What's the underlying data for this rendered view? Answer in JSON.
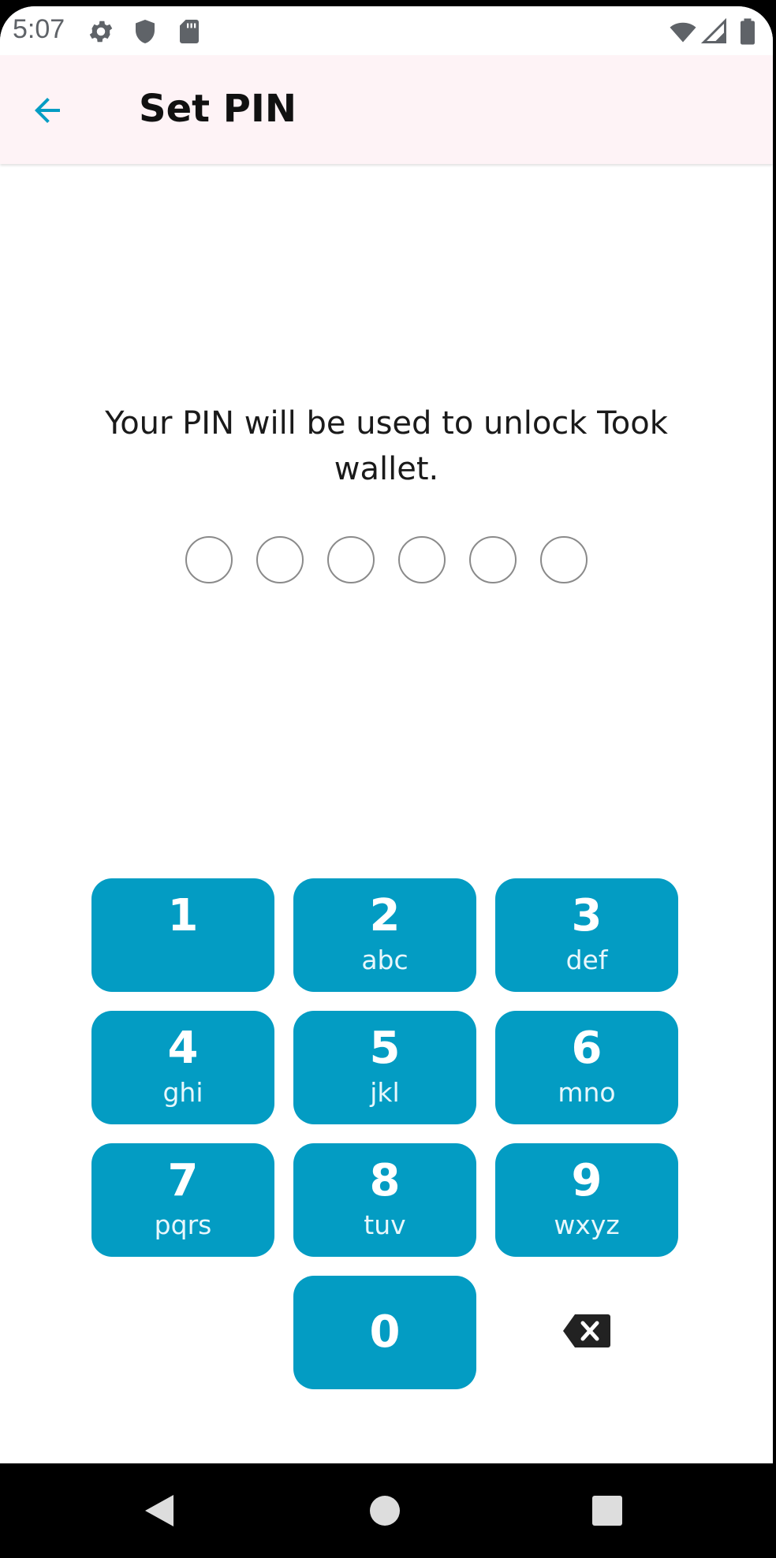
{
  "status_bar": {
    "time": "5:07",
    "left_icons": [
      "gear-icon",
      "shield-icon",
      "sd-card-icon"
    ],
    "right_icons": [
      "wifi-icon",
      "signal-icon",
      "battery-icon"
    ]
  },
  "app_bar": {
    "title": "Set PIN",
    "back_icon": "arrow-left-icon"
  },
  "prompt": {
    "text": "Your PIN will be used to unlock Took wallet."
  },
  "pin": {
    "length": 6,
    "filled": 0
  },
  "keypad": {
    "keys": [
      {
        "digit": "1",
        "letters": ""
      },
      {
        "digit": "2",
        "letters": "abc"
      },
      {
        "digit": "3",
        "letters": "def"
      },
      {
        "digit": "4",
        "letters": "ghi"
      },
      {
        "digit": "5",
        "letters": "jkl"
      },
      {
        "digit": "6",
        "letters": "mno"
      },
      {
        "digit": "7",
        "letters": "pqrs"
      },
      {
        "digit": "8",
        "letters": "tuv"
      },
      {
        "digit": "9",
        "letters": "wxyz"
      }
    ],
    "zero": {
      "digit": "0"
    },
    "backspace_icon": "backspace-icon"
  },
  "colors": {
    "accent": "#039cc3",
    "app_bar_bg": "#fef3f6",
    "title_text": "#111111",
    "dot_border": "#8a8a8a"
  },
  "nav_bar": {
    "buttons": [
      "back-triangle-icon",
      "home-circle-icon",
      "recents-square-icon"
    ]
  }
}
